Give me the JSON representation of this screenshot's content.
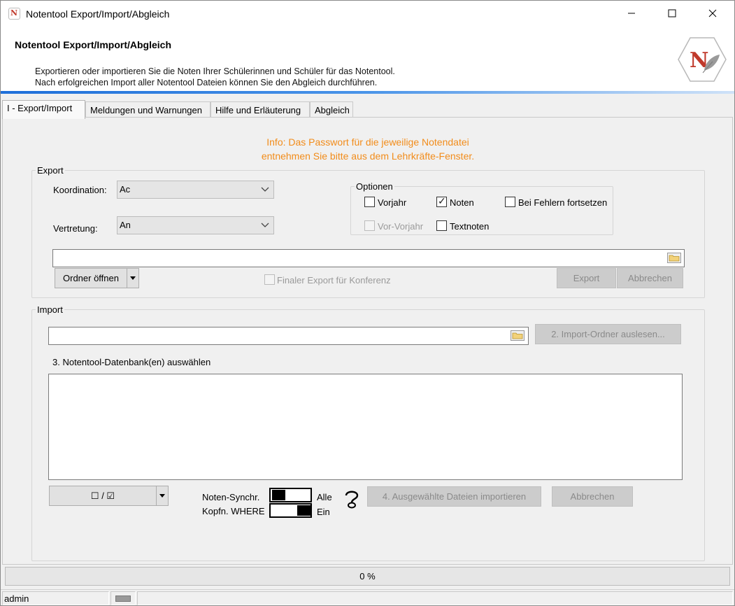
{
  "window": {
    "title": "Notentool Export/Import/Abgleich",
    "minimize": "—",
    "maximize": "☐",
    "close": "✕"
  },
  "header": {
    "title": "Notentool Export/Import/Abgleich",
    "desc_line1": "Exportieren oder importieren Sie die Noten Ihrer Schülerinnen und Schüler für das Notentool.",
    "desc_line2": "Nach erfolgreichen Import aller Notentool Dateien können Sie den Abgleich durchführen."
  },
  "tabs": [
    {
      "label": "I - Export/Import"
    },
    {
      "label": "Meldungen und Warnungen"
    },
    {
      "label": "Hilfe und Erläuterung"
    },
    {
      "label": "Abgleich"
    }
  ],
  "info": {
    "line1": "Info: Das Passwort für die jeweilige Notendatei",
    "line2": "entnehmen Sie bitte aus dem Lehrkräfte-Fenster."
  },
  "export": {
    "group_label": "Export",
    "koordination_label": "Koordination:",
    "koordination_value": "Ac",
    "vertretung_label": "Vertretung:",
    "vertretung_value": "An",
    "optionen_label": "Optionen",
    "options": {
      "vorjahr": {
        "label": "Vorjahr",
        "checked": false
      },
      "noten": {
        "label": "Noten",
        "checked": true
      },
      "fehler": {
        "label": "Bei Fehlern fortsetzen",
        "checked": false
      },
      "vorvorjahr": {
        "label": "Vor-Vorjahr",
        "checked": false,
        "disabled": true
      },
      "textnoten": {
        "label": "Textnoten",
        "checked": false
      }
    },
    "path_value": "",
    "ordner_button": "Ordner öffnen",
    "ordner_dropdown": "▾",
    "final_export_label": "Finaler Export für Konferenz",
    "export_button": "Export",
    "cancel_button": "Abbrechen"
  },
  "import": {
    "group_label": "Import",
    "path_value": "",
    "read_button": "2. Import-Ordner auslesen...",
    "db_label": "3. Notentool-Datenbank(en) auswählen",
    "select_toggle": "☐ / ☑",
    "select_dropdown": "▾",
    "sync_label": "Noten-Synchr.",
    "sync_value": "Alle",
    "kopfn_label": "Kopfn. WHERE",
    "kopfn_value": "Ein",
    "help_icon": "?",
    "import_button": "4. Ausgewählte Dateien importieren",
    "cancel_button": "Abbrechen"
  },
  "progress": {
    "value": "0 %",
    "fraction": 0
  },
  "status": {
    "user": "admin"
  },
  "colors": {
    "accent_blue": "#1e6fd9",
    "info_orange": "#f28c1a",
    "logo_red": "#c0392b"
  }
}
